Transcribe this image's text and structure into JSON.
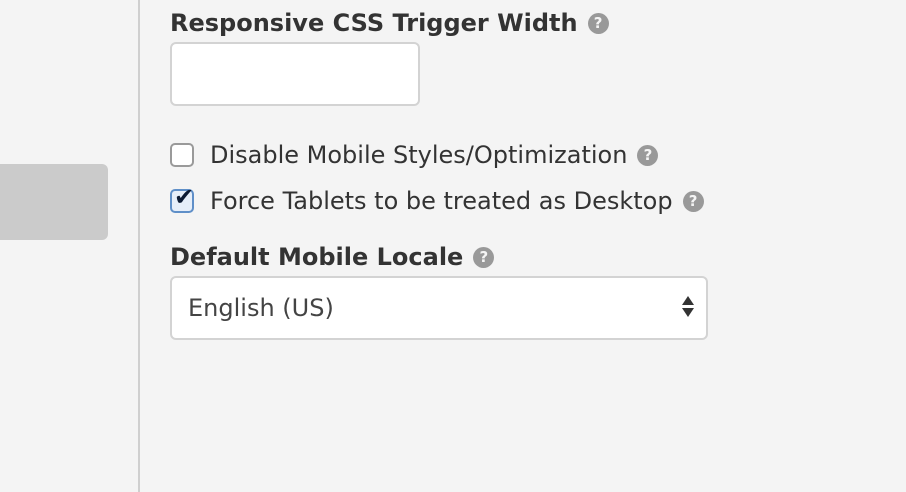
{
  "settings": {
    "responsive_width": {
      "title": "Responsive CSS Trigger Width",
      "help_glyph": "?",
      "value": ""
    },
    "disable_mobile": {
      "label": "Disable Mobile Styles/Optimization",
      "checked": false,
      "help_glyph": "?"
    },
    "force_tablets": {
      "label": "Force Tablets to be treated as Desktop",
      "checked": true,
      "help_glyph": "?"
    },
    "mobile_locale": {
      "title": "Default Mobile Locale",
      "help_glyph": "?",
      "selected": "English (US)"
    }
  },
  "icons": {
    "help": "question-circle-icon",
    "check": "checkmark-icon",
    "select": "up-down-arrows-icon"
  },
  "colors": {
    "background": "#f4f4f4",
    "divider": "#cfcfcf",
    "side_block": "#cbcbcb",
    "help_icon": "#999999",
    "checked_border": "#5f8fc8"
  }
}
